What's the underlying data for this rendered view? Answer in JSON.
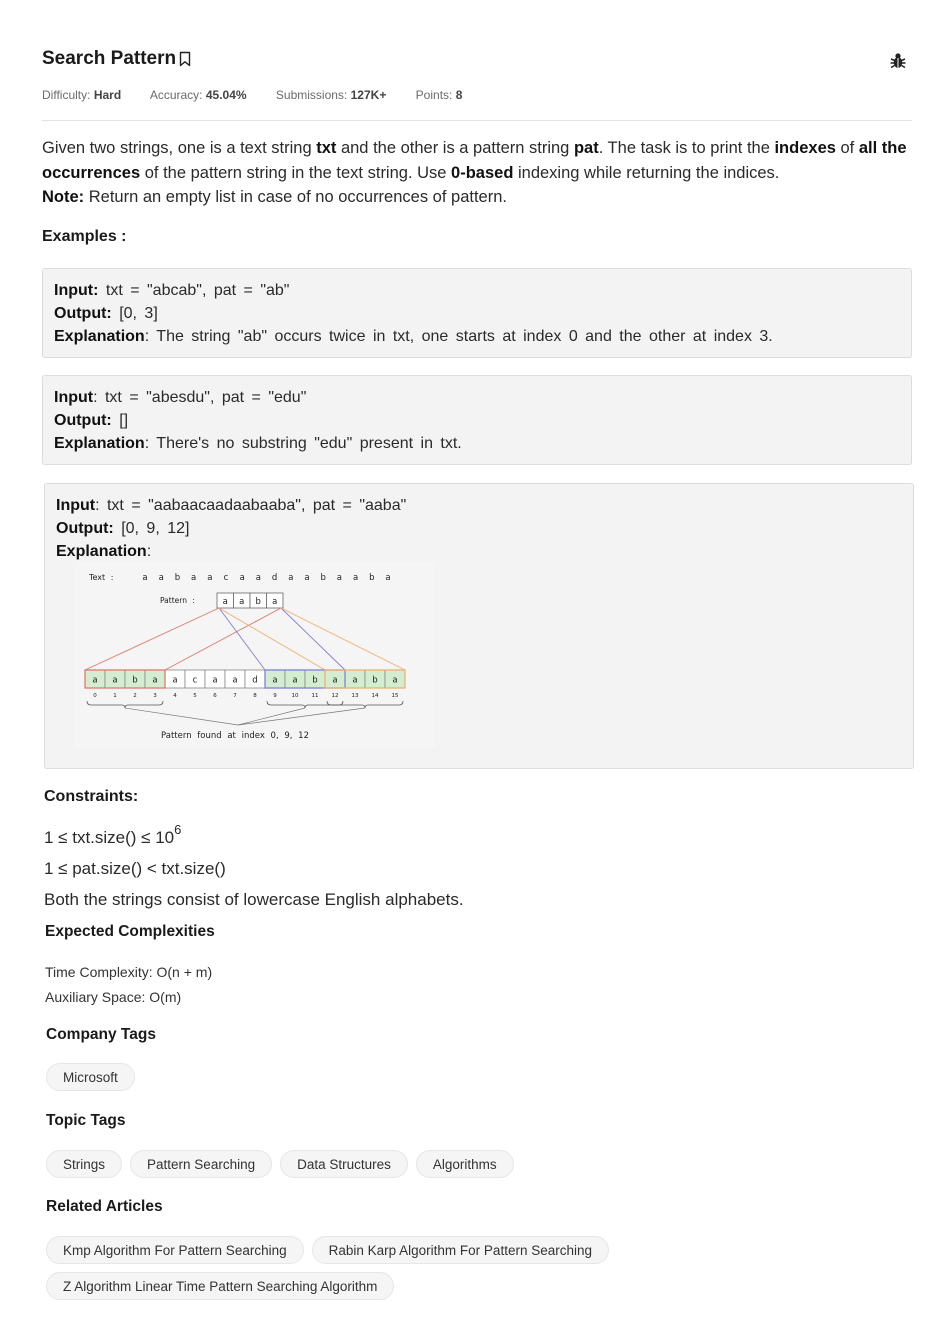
{
  "header": {
    "title": "Search Pattern",
    "bookmark_icon": "bookmark-icon",
    "bug_icon": "bug-icon"
  },
  "meta": {
    "difficulty_label": "Difficulty:",
    "difficulty_value": "Hard",
    "accuracy_label": "Accuracy:",
    "accuracy_value": "45.04%",
    "submissions_label": "Submissions:",
    "submissions_value": "127K+",
    "points_label": "Points:",
    "points_value": "8"
  },
  "description": {
    "p1": "Given two strings, one is a text string ",
    "txt": "txt",
    "p2": " and the other is a pattern string ",
    "pat": "pat",
    "p3": ". The task is to print the ",
    "indexes": "indexes",
    "p4": " of ",
    "all_occ": "all the occurrences",
    "p5": " of the pattern string in the text string. Use ",
    "zero_based": "0-based",
    "p6": " indexing while returning the indices.",
    "note_label": "Note:",
    "note_text": " Return an empty list in case of no occurrences of pattern."
  },
  "examples": {
    "heading": "Examples :",
    "ex1": {
      "input_label": "Input:",
      "input": " txt = \"abcab\", pat = \"ab\"",
      "output_label": "Output:",
      "output": " [0, 3]",
      "explanation_label": "Explanation",
      "explanation": ": The string \"ab\" occurs twice in txt, one starts at index 0 and the other at index 3."
    },
    "ex2": {
      "input_label": "Input",
      "input": ": txt = \"abesdu\", pat = \"edu\"",
      "output_label": "Output:",
      "output": " []",
      "explanation_label": "Explanation",
      "explanation": ": There's no substring \"edu\" present in txt."
    },
    "ex3": {
      "input_label": "Input",
      "input": ": txt = \"aabaacaadaabaaba\", pat = \"aaba\"",
      "output_label": "Output:",
      "output": " [0, 9, 12]",
      "explanation_label": "Explanation",
      "explanation": ":",
      "diagram": {
        "text_label": "Text :",
        "text_chars": [
          "a",
          "a",
          "b",
          "a",
          "a",
          "c",
          "a",
          "a",
          "d",
          "a",
          "a",
          "b",
          "a",
          "a",
          "b",
          "a"
        ],
        "pattern_label": "Pattern :",
        "pattern_chars": [
          "a",
          "a",
          "b",
          "a"
        ],
        "cell_chars": [
          "a",
          "a",
          "b",
          "a",
          "a",
          "c",
          "a",
          "a",
          "d",
          "a",
          "a",
          "b",
          "a",
          "a",
          "b",
          "a"
        ],
        "indices": [
          "0",
          "1",
          "2",
          "3",
          "4",
          "5",
          "6",
          "7",
          "8",
          "9",
          "10",
          "11",
          "12",
          "13",
          "14",
          "15"
        ],
        "caption": "Pattern found at index 0, 9, 12",
        "colors": {
          "match_fill": "#d4ecd0",
          "red": "#e07a6e",
          "blue": "#8080d8",
          "orange": "#f0b070"
        }
      }
    }
  },
  "constraints": {
    "heading": "Constraints:",
    "c1_text": "1 ≤ txt.size() ≤ 10",
    "c1_sup": "6",
    "c2": "1 ≤ pat.size() < txt.size()",
    "c3": "Both the strings consist of lowercase English alphabets."
  },
  "complexities": {
    "heading": "Expected Complexities",
    "time": "Time Complexity: O(n + m)",
    "space": "Auxiliary Space: O(m)"
  },
  "company_tags": {
    "heading": "Company Tags",
    "items": [
      "Microsoft"
    ]
  },
  "topic_tags": {
    "heading": "Topic Tags",
    "items": [
      "Strings",
      "Pattern Searching",
      "Data Structures",
      "Algorithms"
    ]
  },
  "related_articles": {
    "heading": "Related Articles",
    "items": [
      "Kmp Algorithm For Pattern Searching",
      "Rabin Karp Algorithm For Pattern Searching",
      "Z Algorithm Linear Time Pattern Searching Algorithm"
    ]
  }
}
